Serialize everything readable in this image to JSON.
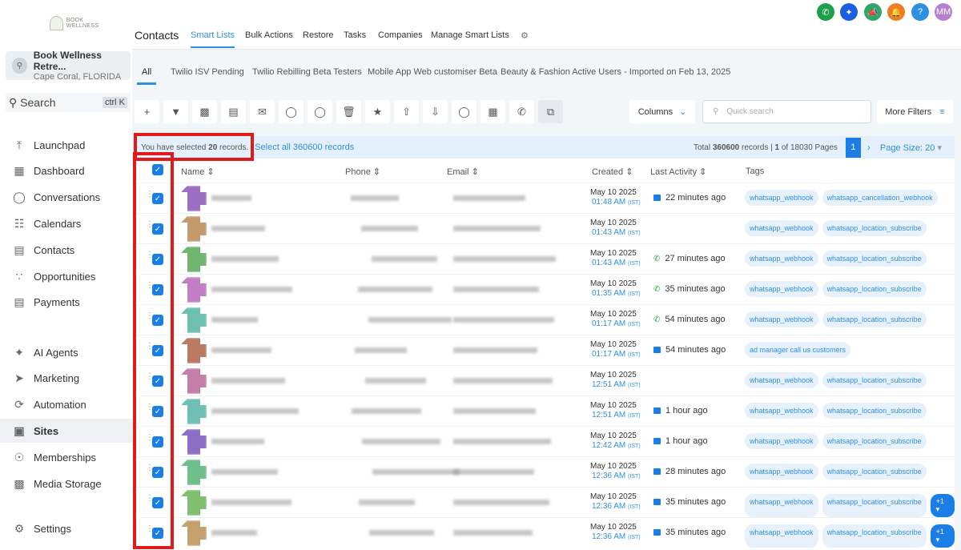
{
  "logo_text": "BOOK WELLNESS RETREATS",
  "account": {
    "name": "Book Wellness Retre...",
    "location": "Cape Coral, FLORIDA"
  },
  "search": {
    "label": "Search",
    "shortcut": "ctrl K"
  },
  "nav": [
    {
      "label": "Launchpad",
      "icon": "rocket-icon"
    },
    {
      "label": "Dashboard",
      "icon": "grid-icon"
    },
    {
      "label": "Conversations",
      "icon": "chat-icon"
    },
    {
      "label": "Calendars",
      "icon": "calendar-icon"
    },
    {
      "label": "Contacts",
      "icon": "contacts-icon"
    },
    {
      "label": "Opportunities",
      "icon": "funnel-icon"
    },
    {
      "label": "Payments",
      "icon": "payments-icon"
    },
    {
      "label": "AI Agents",
      "icon": "sparkle-icon"
    },
    {
      "label": "Marketing",
      "icon": "send-icon"
    },
    {
      "label": "Automation",
      "icon": "automation-icon"
    },
    {
      "label": "Sites",
      "icon": "sites-icon"
    },
    {
      "label": "Memberships",
      "icon": "membership-icon"
    },
    {
      "label": "Media Storage",
      "icon": "image-icon"
    },
    {
      "label": "Settings",
      "icon": "gear-icon"
    }
  ],
  "user_initials": "MM",
  "header": {
    "title": "Contacts",
    "tabs": [
      "Smart Lists",
      "Bulk Actions",
      "Restore",
      "Tasks",
      "Companies",
      "Manage Smart Lists"
    ]
  },
  "smart_lists": [
    "All",
    "Twilio ISV Pending",
    "Twilio Rebilling Beta Testers",
    "Mobile App Web customiser Beta",
    "Beauty & Fashion Active Users - Imported on Feb 13, 2025"
  ],
  "toolbar": {
    "columns": "Columns",
    "quick_search_placeholder": "Quick search",
    "more_filters": "More Filters"
  },
  "selection": {
    "prefix": "You have selected ",
    "count": "20",
    "suffix": " records.",
    "select_all": "Select all 360600 records"
  },
  "pagination": {
    "total_prefix": "Total ",
    "total": "360600",
    "total_mid": " records | ",
    "page": "1",
    "pages_suffix": " of 18030 Pages",
    "current": "1",
    "page_size": "Page Size: 20"
  },
  "columns": [
    "Name",
    "Phone",
    "Email",
    "Created",
    "Last Activity",
    "Tags"
  ],
  "rows": [
    {
      "date": "May 10 2025",
      "time": "01:48 AM",
      "tz": "(IST)",
      "act_type": "email",
      "activity": "22 minutes ago",
      "tags": [
        "whatsapp_webhook",
        "whatsapp_cancellation_webhook"
      ],
      "color": "#9b6fc4",
      "more": ""
    },
    {
      "date": "May 10 2025",
      "time": "01:43 AM",
      "tz": "(IST)",
      "act_type": "",
      "activity": "",
      "tags": [
        "whatsapp_webhook",
        "whatsapp_location_subscribe"
      ],
      "color": "#c49a6c",
      "more": ""
    },
    {
      "date": "May 10 2025",
      "time": "01:43 AM",
      "tz": "(IST)",
      "act_type": "whatsapp",
      "activity": "27 minutes ago",
      "tags": [
        "whatsapp_webhook",
        "whatsapp_location_subscribe"
      ],
      "color": "#6fb46f",
      "more": ""
    },
    {
      "date": "May 10 2025",
      "time": "01:35 AM",
      "tz": "(IST)",
      "act_type": "whatsapp",
      "activity": "35 minutes ago",
      "tags": [
        "whatsapp_webhook",
        "whatsapp_location_subscribe"
      ],
      "color": "#c47fc4",
      "more": ""
    },
    {
      "date": "May 10 2025",
      "time": "01:17 AM",
      "tz": "(IST)",
      "act_type": "whatsapp",
      "activity": "54 minutes ago",
      "tags": [
        "whatsapp_webhook",
        "whatsapp_location_subscribe"
      ],
      "color": "#6fbfb0",
      "more": ""
    },
    {
      "date": "May 10 2025",
      "time": "01:17 AM",
      "tz": "(IST)",
      "act_type": "email",
      "activity": "54 minutes ago",
      "tags": [
        "ad manager call us customers"
      ],
      "color": "#b87a62",
      "more": ""
    },
    {
      "date": "May 10 2025",
      "time": "12:51 AM",
      "tz": "(IST)",
      "act_type": "",
      "activity": "",
      "tags": [
        "whatsapp_webhook",
        "whatsapp_location_subscribe"
      ],
      "color": "#c47fa8",
      "more": ""
    },
    {
      "date": "May 10 2025",
      "time": "12:51 AM",
      "tz": "(IST)",
      "act_type": "email",
      "activity": "1 hour ago",
      "tags": [
        "whatsapp_webhook",
        "whatsapp_location_subscribe"
      ],
      "color": "#6fbfb5",
      "more": ""
    },
    {
      "date": "May 10 2025",
      "time": "12:42 AM",
      "tz": "(IST)",
      "act_type": "email",
      "activity": "1 hour ago",
      "tags": [
        "whatsapp_webhook",
        "whatsapp_location_subscribe"
      ],
      "color": "#8a6fc4",
      "more": ""
    },
    {
      "date": "May 10 2025",
      "time": "12:36 AM",
      "tz": "(IST)",
      "act_type": "email",
      "activity": "28 minutes ago",
      "tags": [
        "whatsapp_webhook",
        "whatsapp_location_subscribe"
      ],
      "color": "#6fbf8a",
      "more": ""
    },
    {
      "date": "May 10 2025",
      "time": "12:36 AM",
      "tz": "(IST)",
      "act_type": "email",
      "activity": "35 minutes ago",
      "tags": [
        "whatsapp_webhook",
        "whatsapp_location_subscribe"
      ],
      "color": "#7fbf6f",
      "more": "+1"
    },
    {
      "date": "May 10 2025",
      "time": "12:36 AM",
      "tz": "(IST)",
      "act_type": "email",
      "activity": "35 minutes ago",
      "tags": [
        "whatsapp_webhook",
        "whatsapp_location_subscribe"
      ],
      "color": "#c4a06f",
      "more": "+1"
    }
  ]
}
